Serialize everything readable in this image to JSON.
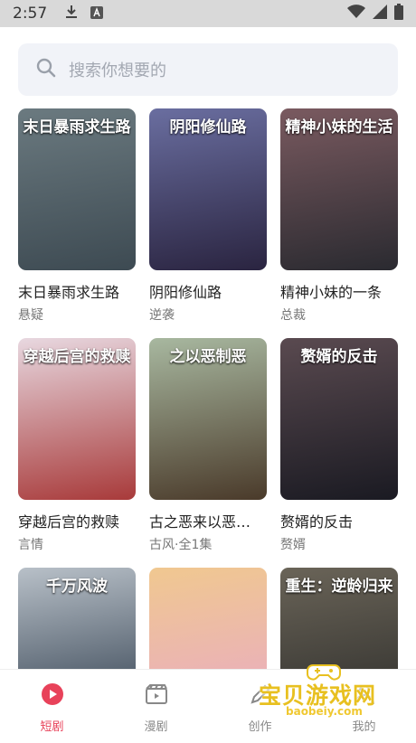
{
  "status_bar": {
    "time": "2:57"
  },
  "search": {
    "placeholder": "搜索你想要的"
  },
  "dramas": [
    {
      "cover_title": "末日暴雨求生路",
      "name": "末日暴雨求生路",
      "tag": "悬疑",
      "colors": [
        "#3d4a52",
        "#6b7a80"
      ]
    },
    {
      "cover_title": "阴阳修仙路",
      "name": "阴阳修仙路",
      "tag": "逆袭",
      "colors": [
        "#2a2440",
        "#6a6ea0"
      ]
    },
    {
      "cover_title": "精神小妹的生活",
      "name": "精神小妹的一条",
      "tag": "总裁",
      "colors": [
        "#2a2a30",
        "#7a5a60"
      ]
    },
    {
      "cover_title": "穿越后宫的救赎",
      "name": "穿越后宫的救赎",
      "tag": "言情",
      "colors": [
        "#a83a3a",
        "#e8d8e0"
      ]
    },
    {
      "cover_title": "之以恶制恶",
      "name": "古之恶来以恶…",
      "tag": "古风·全1集",
      "colors": [
        "#4a3a2a",
        "#a8b8a0"
      ]
    },
    {
      "cover_title": "赘婿的反击",
      "name": "赘婿的反击",
      "tag": "赘婿",
      "colors": [
        "#1a1a22",
        "#5a4a50"
      ]
    },
    {
      "cover_title": "千万风波",
      "name": "",
      "tag": "",
      "colors": [
        "#2a3848",
        "#b8c0c8"
      ]
    },
    {
      "cover_title": "",
      "name": "",
      "tag": "",
      "colors": [
        "#e8a8c8",
        "#f0c890"
      ]
    },
    {
      "cover_title": "重生：逆龄归来",
      "name": "",
      "tag": "",
      "colors": [
        "#2a2a28",
        "#6a6458"
      ]
    }
  ],
  "nav": [
    {
      "label": "短剧",
      "icon": "play-circle-icon",
      "active": true
    },
    {
      "label": "漫剧",
      "icon": "clapper-icon",
      "active": false
    },
    {
      "label": "创作",
      "icon": "pen-icon",
      "active": false
    },
    {
      "label": "我的",
      "icon": "person-icon",
      "active": false
    }
  ],
  "watermark": {
    "text": "宝贝游戏网",
    "url": "baobeiy.com"
  },
  "colors": {
    "accent": "#e8425a",
    "search_bg": "#f1f3f8"
  }
}
